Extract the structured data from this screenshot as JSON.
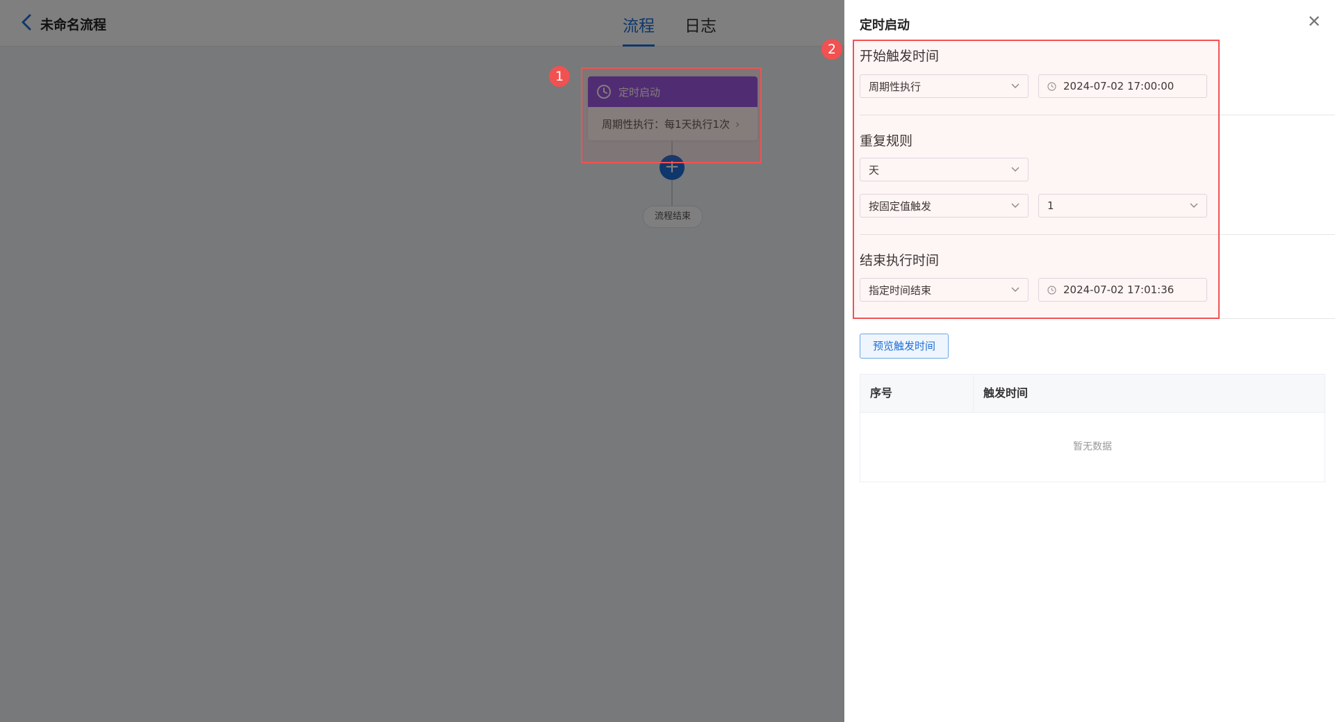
{
  "header": {
    "title": "未命名流程",
    "tabs": [
      {
        "label": "流程",
        "active": true
      },
      {
        "label": "日志",
        "active": false
      }
    ]
  },
  "flow": {
    "start_node": {
      "title": "定时启动",
      "summary": "周期性执行：每1天执行1次"
    },
    "end_node": {
      "label": "流程结束"
    }
  },
  "annotations": [
    "1",
    "2"
  ],
  "drawer": {
    "title": "定时启动",
    "start_trigger": {
      "label": "开始触发时间",
      "mode": "周期性执行",
      "datetime": "2024-07-02 17:00:00"
    },
    "repeat_rule": {
      "label": "重复规则",
      "unit": "天",
      "trigger_type": "按固定值触发",
      "value": "1"
    },
    "end_time": {
      "label": "结束执行时间",
      "mode": "指定时间结束",
      "datetime": "2024-07-02 17:01:36"
    },
    "preview_button": "预览触发时间",
    "table": {
      "columns": [
        "序号",
        "触发时间"
      ],
      "empty_text": "暂无数据"
    }
  },
  "colors": {
    "primary": "#1f6fd6",
    "node_header": "#8e54e9",
    "annotation": "#f25151"
  }
}
